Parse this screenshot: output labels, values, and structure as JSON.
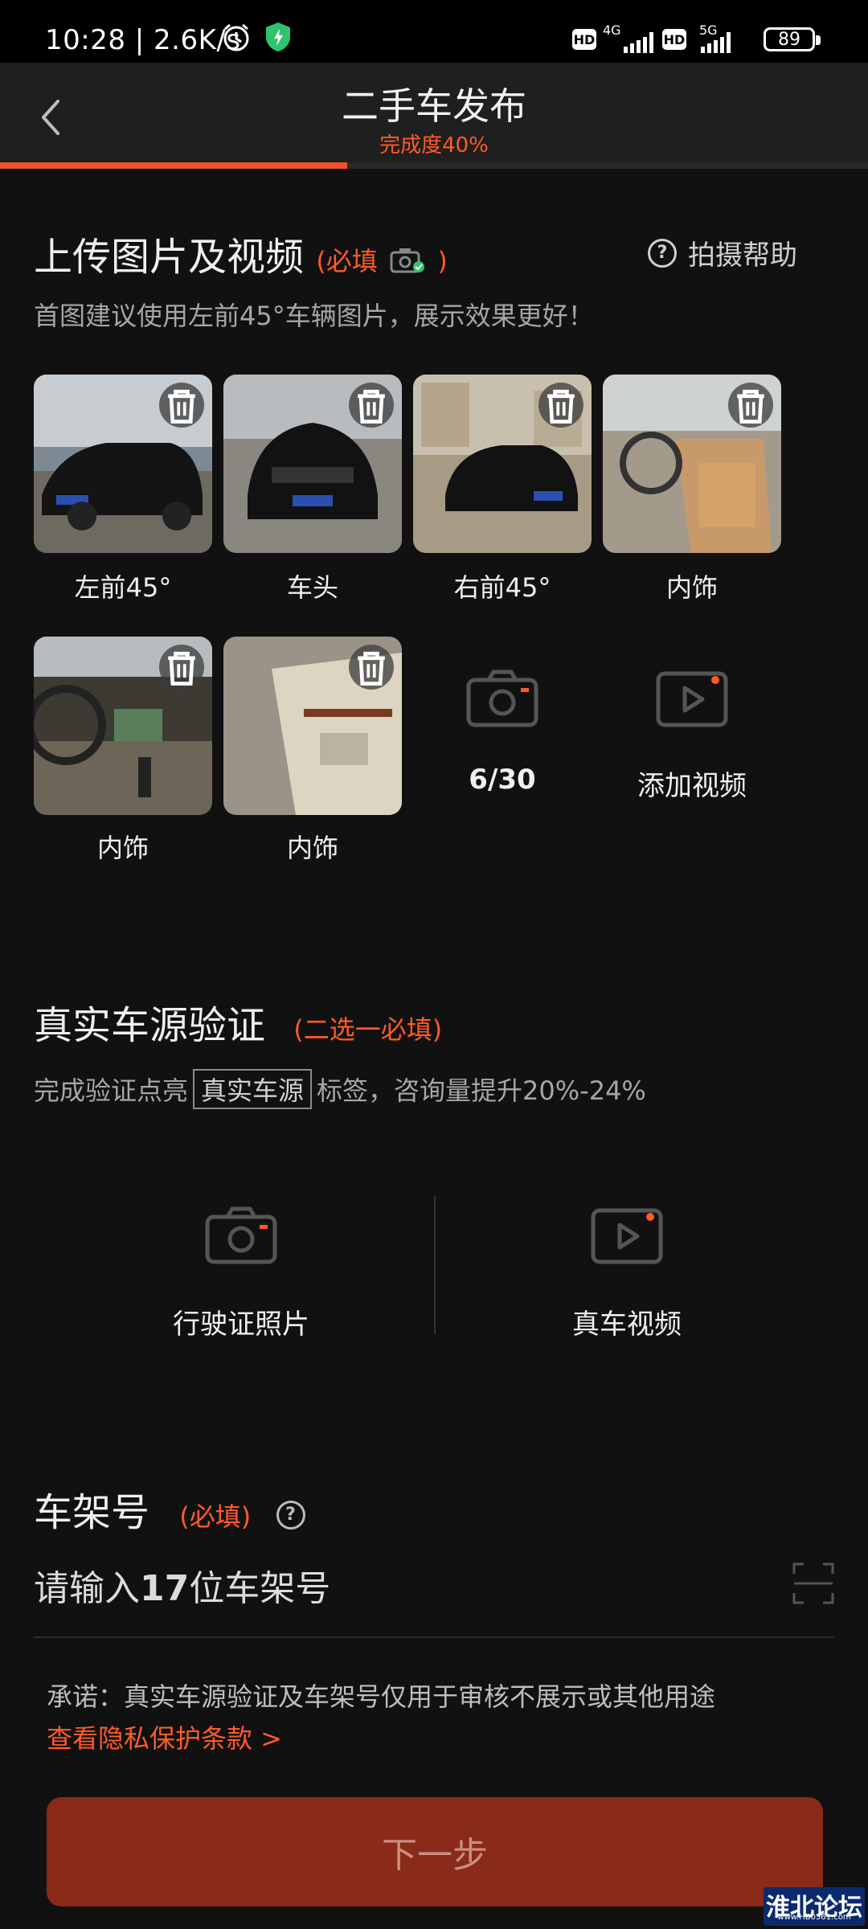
{
  "status_bar": {
    "time": "10:28 | 2.6K/s",
    "net1": "4G",
    "net2": "5G",
    "hd": "HD",
    "battery": "89"
  },
  "nav": {
    "title": "二手车发布",
    "subtitle": "完成度40%",
    "progress": 0.4
  },
  "upload": {
    "title": "上传图片及视频",
    "required": "(必填",
    "required_close": ")",
    "help": "拍摄帮助",
    "hint": "首图建议使用左前45°车辆图片，展示效果更好！",
    "photos": [
      {
        "label": "左前45°"
      },
      {
        "label": "车头"
      },
      {
        "label": "右前45°"
      },
      {
        "label": "内饰"
      },
      {
        "label": "内饰"
      },
      {
        "label": "内饰"
      }
    ],
    "count": "6/30",
    "add_video": "添加视频"
  },
  "verify": {
    "title": "真实车源验证",
    "required": "(二选一必填)",
    "hint_before": "完成验证点亮",
    "tag": "真实车源",
    "hint_after": "标签，咨询量提升20%-24%",
    "option1": "行驶证照片",
    "option2": "真车视频"
  },
  "vin": {
    "title": "车架号",
    "required": "(必填)",
    "placeholder_prefix": "请输入",
    "placeholder_num": "17",
    "placeholder_suffix": "位车架号"
  },
  "promise": "承诺：真实车源验证及车架号仅用于审核不展示或其他用途",
  "privacy_link": "查看隐私保护条款 >",
  "next_button": "下一步",
  "watermark": {
    "title": "淮北论坛",
    "url": "www.HB0561.com"
  },
  "colors": {
    "accent": "#ff5b27",
    "button": "#8a2a18",
    "background": "#111111"
  }
}
